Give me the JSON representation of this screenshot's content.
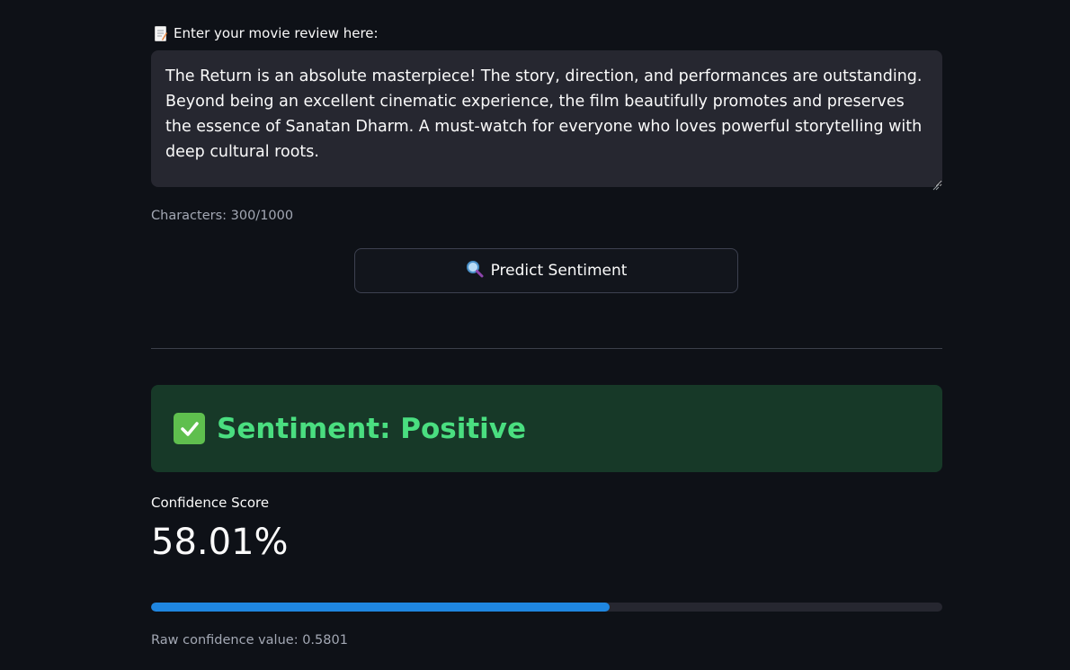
{
  "review_input": {
    "label": "Enter your movie review here:",
    "label_icon": "memo-icon",
    "value": "The Return is an absolute masterpiece! The story, direction, and performances are outstanding. Beyond being an excellent cinematic experience, the film beautifully promotes and preserves the essence of Sanatan Dharm. A must-watch for everyone who loves powerful storytelling with deep cultural roots."
  },
  "char_count": "Characters: 300/1000",
  "predict_button": {
    "icon": "magnifier-icon",
    "label": "Predict Sentiment"
  },
  "result": {
    "icon": "check-mark-icon",
    "text": "Sentiment: Positive",
    "accent_color": "#4ade80",
    "background_color": "#173928"
  },
  "confidence": {
    "label": "Confidence Score",
    "value_text": "58.01%",
    "progress_fraction": 0.5801,
    "progress_color": "#1f86e0",
    "raw_text": "Raw confidence value: 0.5801"
  }
}
